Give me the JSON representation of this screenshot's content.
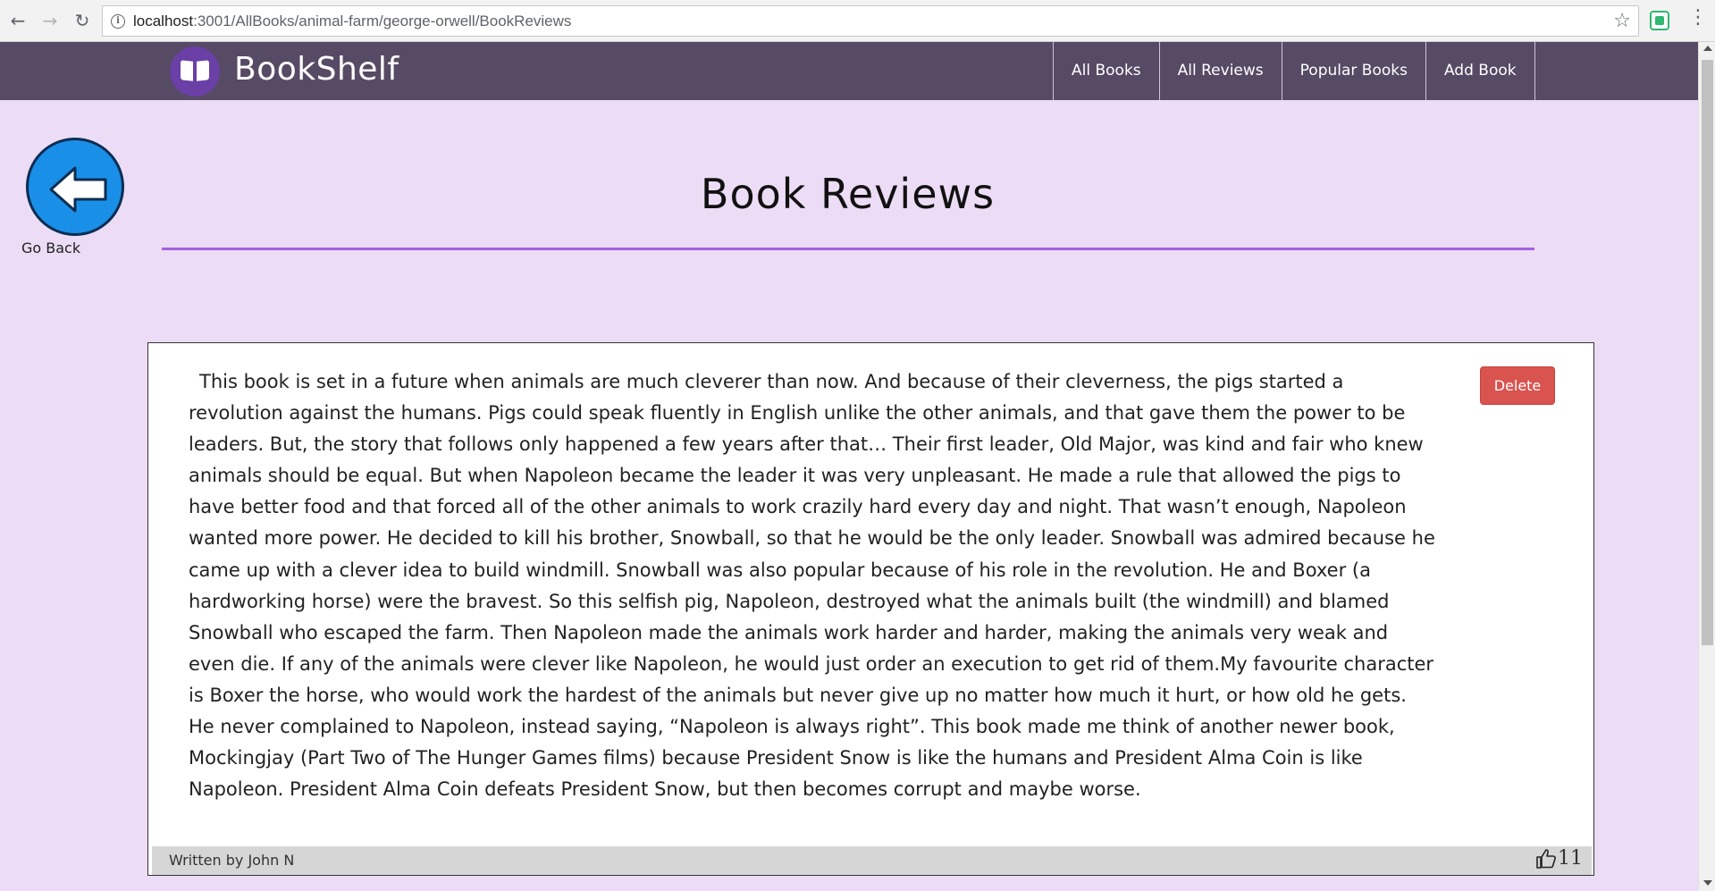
{
  "browser": {
    "url_host": "localhost",
    "url_path": ":3001/AllBooks/animal-farm/george-orwell/BookReviews",
    "icons": [
      "back-icon",
      "forward-icon",
      "reload-icon",
      "info-icon",
      "star-icon",
      "extension-icon",
      "menu-icon"
    ]
  },
  "header": {
    "brand": "BookShelf",
    "nav": [
      "All Books",
      "All Reviews",
      "Popular Books",
      "Add Book"
    ]
  },
  "go_back": {
    "label": "Go Back"
  },
  "page": {
    "title": "Book Reviews"
  },
  "review": {
    "text": "This book is set in a future when animals are much cleverer than now. And because of their cleverness, the pigs started a revolution against the humans. Pigs could speak fluently in English unlike the other animals, and that gave them the power to be leaders. But, the story that follows only happened a few years after that… Their first leader, Old Major, was kind and fair who knew animals should be equal. But when Napoleon became the leader it was very unpleasant. He made a rule that allowed the pigs to have better food and that forced all of the other animals to work crazily hard every day and night. That wasn’t enough, Napoleon wanted more power. He decided to kill his brother, Snowball, so that he would be the only leader. Snowball was admired because he came up with a clever idea to build windmill. Snowball was also popular because of his role in the revolution. He and Boxer (a hardworking horse) were the bravest. So this selfish pig, Napoleon, destroyed what the animals built (the windmill) and blamed Snowball who escaped the farm. Then Napoleon made the animals work harder and harder, making the animals very weak and even die. If any of the animals were clever like Napoleon, he would just order an execution to get rid of them.My favourite character is Boxer the horse, who would work the hardest of the animals but never give up no matter how much it hurt, or how old he gets. He never complained to Napoleon, instead saying, “Napoleon is always right”. This book made me think of another newer book, Mockingjay (Part Two of The Hunger Games films) because President Snow is like the humans and President Alma Coin is like Napoleon. President Alma Coin defeats President Snow, but then becomes corrupt and maybe worse.",
    "delete_label": "Delete",
    "author": "Written by John N",
    "likes": "11"
  },
  "colors": {
    "page_bg": "#ecdcf5",
    "header_bg": "#574a64",
    "accent_rule": "#a461e0",
    "delete_bg": "#d9534f",
    "back_button": "#1a8fe8"
  }
}
